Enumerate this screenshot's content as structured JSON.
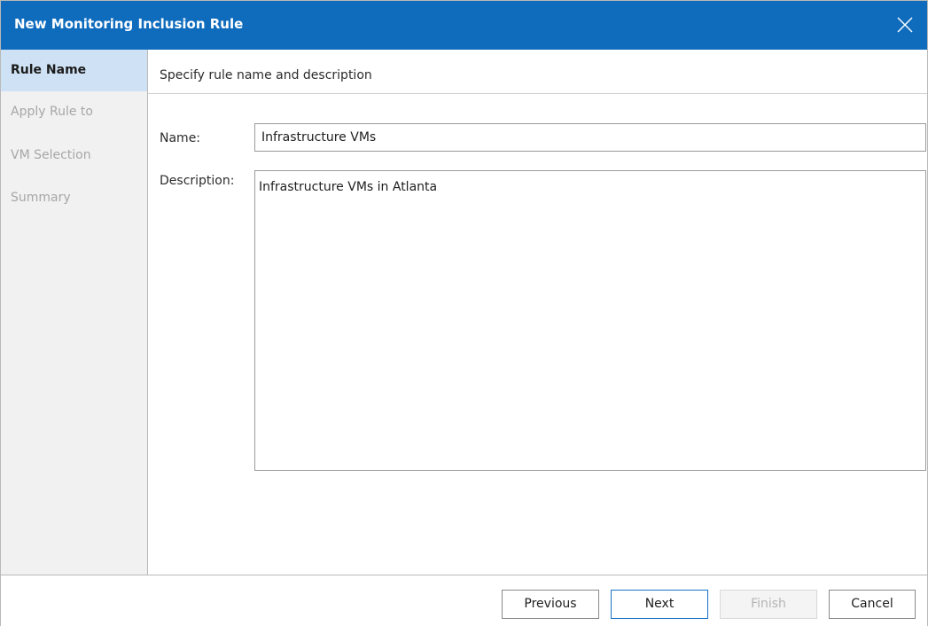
{
  "window": {
    "title": "New Monitoring Inclusion Rule",
    "close_icon": "close-icon"
  },
  "sidebar": {
    "steps": [
      {
        "label": "Rule Name",
        "active": true
      },
      {
        "label": "Apply Rule to",
        "active": false
      },
      {
        "label": "VM Selection",
        "active": false
      },
      {
        "label": "Summary",
        "active": false
      }
    ]
  },
  "main": {
    "header": "Specify rule name and description",
    "name": {
      "label": "Name:",
      "value": "Infrastructure VMs"
    },
    "description": {
      "label": "Description:",
      "value": "Infrastructure VMs in Atlanta"
    }
  },
  "footer": {
    "previous_label": "Previous",
    "next_label": "Next",
    "finish_label": "Finish",
    "cancel_label": "Cancel",
    "finish_enabled": false
  },
  "colors": {
    "titlebar": "#0f6cbd",
    "active_step": "#cfe2f5",
    "primary_border": "#1a71c4"
  }
}
